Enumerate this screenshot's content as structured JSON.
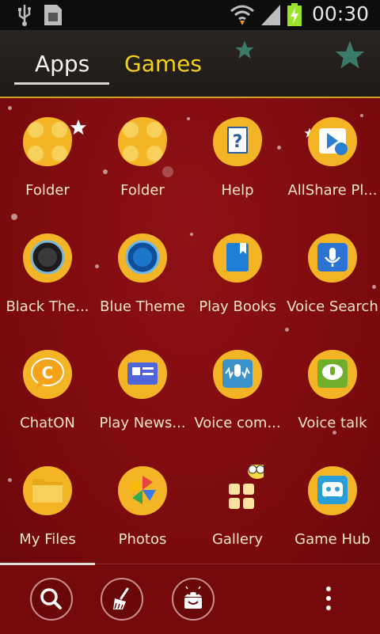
{
  "status_bar": {
    "time": "00:30",
    "icons": [
      "usb-icon",
      "sim-card-icon",
      "wifi-icon",
      "signal-icon",
      "battery-charging-icon"
    ]
  },
  "tabs": [
    {
      "label": "Apps",
      "selected": true
    },
    {
      "label": "Games",
      "selected": false
    }
  ],
  "apps": [
    {
      "label": "Folder",
      "icon": "folder-icon"
    },
    {
      "label": "Folder",
      "icon": "folder-icon"
    },
    {
      "label": "Help",
      "icon": "help-icon"
    },
    {
      "label": "AllShare Pl...",
      "icon": "allshare-play-icon"
    },
    {
      "label": "Black The...",
      "icon": "black-theme-icon"
    },
    {
      "label": "Blue Theme",
      "icon": "blue-theme-icon"
    },
    {
      "label": "Play Books",
      "icon": "play-books-icon"
    },
    {
      "label": "Voice Search",
      "icon": "voice-search-icon"
    },
    {
      "label": "ChatON",
      "icon": "chaton-icon"
    },
    {
      "label": "Play News...",
      "icon": "play-newsstand-icon"
    },
    {
      "label": "Voice com...",
      "icon": "voice-command-icon"
    },
    {
      "label": "Voice talk",
      "icon": "voice-talk-icon"
    },
    {
      "label": "My Files",
      "icon": "my-files-icon"
    },
    {
      "label": "Photos",
      "icon": "photos-icon"
    },
    {
      "label": "Gallery",
      "icon": "gallery-icon"
    },
    {
      "label": "Game Hub",
      "icon": "game-hub-icon"
    }
  ],
  "dock": {
    "buttons": [
      "search-icon",
      "clean-broom-icon",
      "android-store-icon",
      "more-options-icon"
    ]
  },
  "colors": {
    "background": "#7d0b0f",
    "blob": "#f3b526",
    "tab_active": "#f4f4f4",
    "tab_inactive": "#f2d21a",
    "label": "#f4e6c4"
  }
}
